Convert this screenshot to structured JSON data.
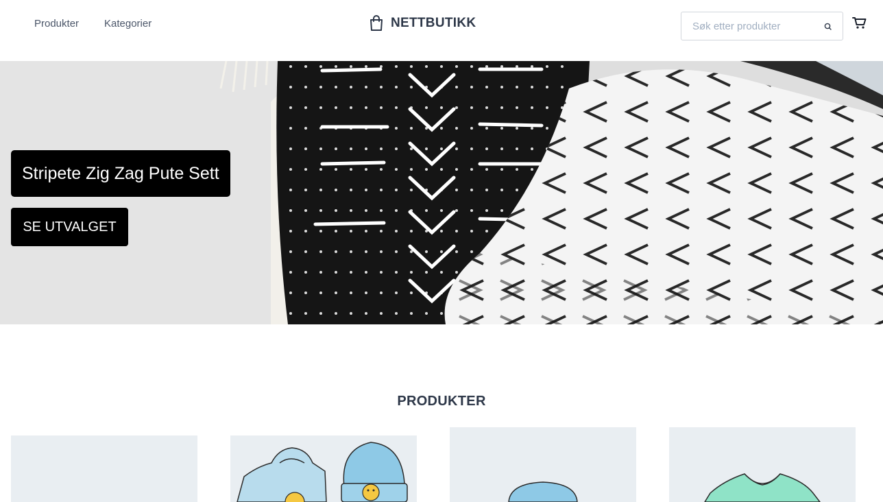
{
  "header": {
    "nav": {
      "products_label": "Produkter",
      "categories_label": "Kategorier"
    },
    "brand": {
      "name": "NETTBUTIKK",
      "icon": "shopping-bag-icon"
    },
    "search": {
      "placeholder": "Søk etter produkter",
      "icon": "search-icon"
    },
    "cart_icon": "cart-icon"
  },
  "hero": {
    "title": "Stripete Zig Zag Pute Sett",
    "button_label": "SE UTVALGET"
  },
  "products_section": {
    "title": "PRODUKTER",
    "cards": [
      {
        "image": "blank-placeholder"
      },
      {
        "image": "hoodie-and-beanie-illustration"
      },
      {
        "image": "blue-beanie-illustration"
      },
      {
        "image": "green-tshirt-illustration"
      }
    ]
  },
  "colors": {
    "text_dark": "#2d3748",
    "hero_button_bg": "#000000",
    "card_bg": "#e9eef2"
  }
}
